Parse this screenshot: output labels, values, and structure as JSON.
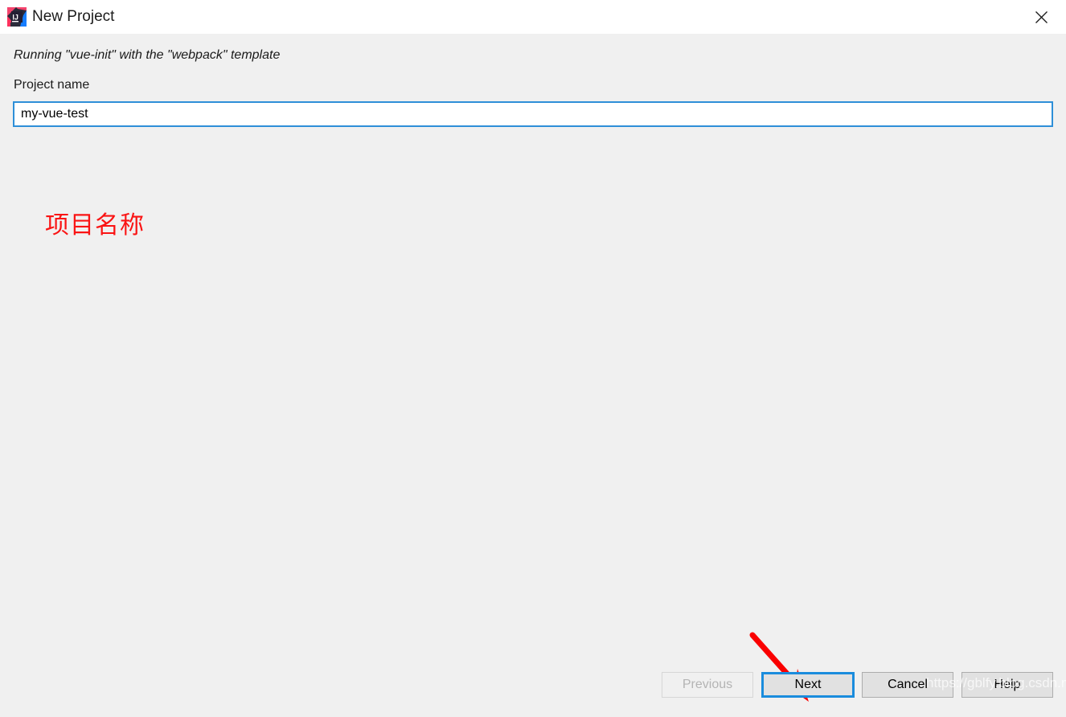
{
  "window": {
    "title": "New Project",
    "icon": "intellij-idea-icon",
    "close_label": "✕",
    "titlebar_bg": "#ffffff",
    "body_bg": "#f0f0f0"
  },
  "dialog": {
    "subtitle": "Running \"vue-init\" with the \"webpack\" template",
    "field": {
      "label": "Project name",
      "value": "my-vue-test",
      "placeholder": "",
      "focus_color": "#2e8fd8"
    }
  },
  "annotations": {
    "text": "项目名称",
    "color": "#fa1414",
    "arrow": {
      "name": "red-arrow-pointing-to-next",
      "color": "#fa0000"
    }
  },
  "buttons": {
    "previous": {
      "label": "Previous",
      "enabled": false
    },
    "next": {
      "label": "Next",
      "enabled": true,
      "focused": true
    },
    "cancel": {
      "label": "Cancel",
      "enabled": true
    },
    "help": {
      "label": "Help",
      "enabled": true
    },
    "focus_color": "#1a8cdd",
    "face_color": "#e1e1e1"
  },
  "watermark": {
    "text": "https://gblfy.blog.csdn.net"
  }
}
